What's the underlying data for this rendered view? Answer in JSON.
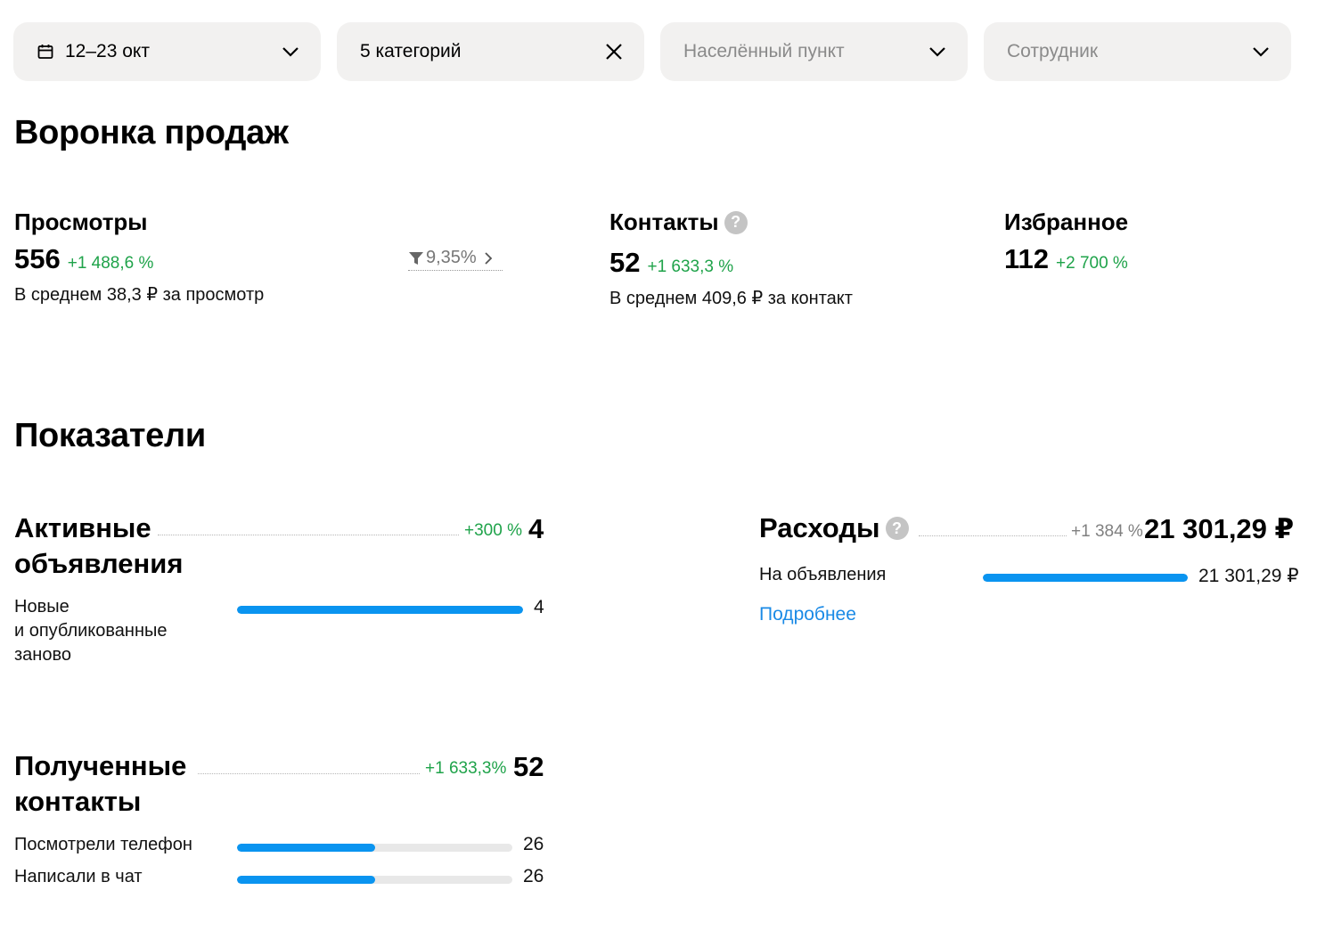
{
  "filters": {
    "date": "12–23 окт",
    "categories": "5 категорий",
    "locality_placeholder": "Населённый пункт",
    "employee_placeholder": "Сотрудник"
  },
  "funnel": {
    "title": "Воронка продаж",
    "views": {
      "label": "Просмотры",
      "value": "556",
      "delta": "+1 488,6 %",
      "sub": "В среднем 38,3 ₽ за просмотр"
    },
    "conversion": "9,35%",
    "contacts": {
      "label": "Контакты",
      "value": "52",
      "delta": "+1 633,3 %",
      "sub": "В среднем 409,6 ₽ за контакт"
    },
    "favorites": {
      "label": "Избранное",
      "value": "112",
      "delta": "+2 700 %"
    }
  },
  "metrics": {
    "title": "Показатели",
    "active_ads": {
      "title_line1": "Активные",
      "title_line2": "объявления",
      "delta": "+300 %",
      "value": "4",
      "bars": [
        {
          "label_line1": "Новые",
          "label_line2": "и опубликованные",
          "label_line3": "заново",
          "value": "4",
          "fraction": 1.0
        }
      ]
    },
    "contacts_received": {
      "title_line1": "Полученные",
      "title_line2": "контакты",
      "delta": "+1 633,3%",
      "value": "52",
      "bars": [
        {
          "label": "Посмотрели телефон",
          "value": "26",
          "fraction": 0.5
        },
        {
          "label": "Написали в чат",
          "value": "26",
          "fraction": 0.5
        }
      ]
    },
    "expenses": {
      "title": "Расходы",
      "delta": "+1 384 %",
      "value": "21 301,29 ₽",
      "bars": [
        {
          "label": "На объявления",
          "value": "21 301,29 ₽",
          "fraction": 1.0
        }
      ],
      "more_link": "Подробнее"
    }
  },
  "colors": {
    "accent": "#0a94f0",
    "positive": "#1fa34a",
    "link": "#1a8ae6",
    "filter_bg": "#f2f1f0"
  },
  "icons": [
    "calendar-icon",
    "chevron-down-icon",
    "close-icon",
    "funnel-icon",
    "chevron-right-icon",
    "help-icon"
  ]
}
